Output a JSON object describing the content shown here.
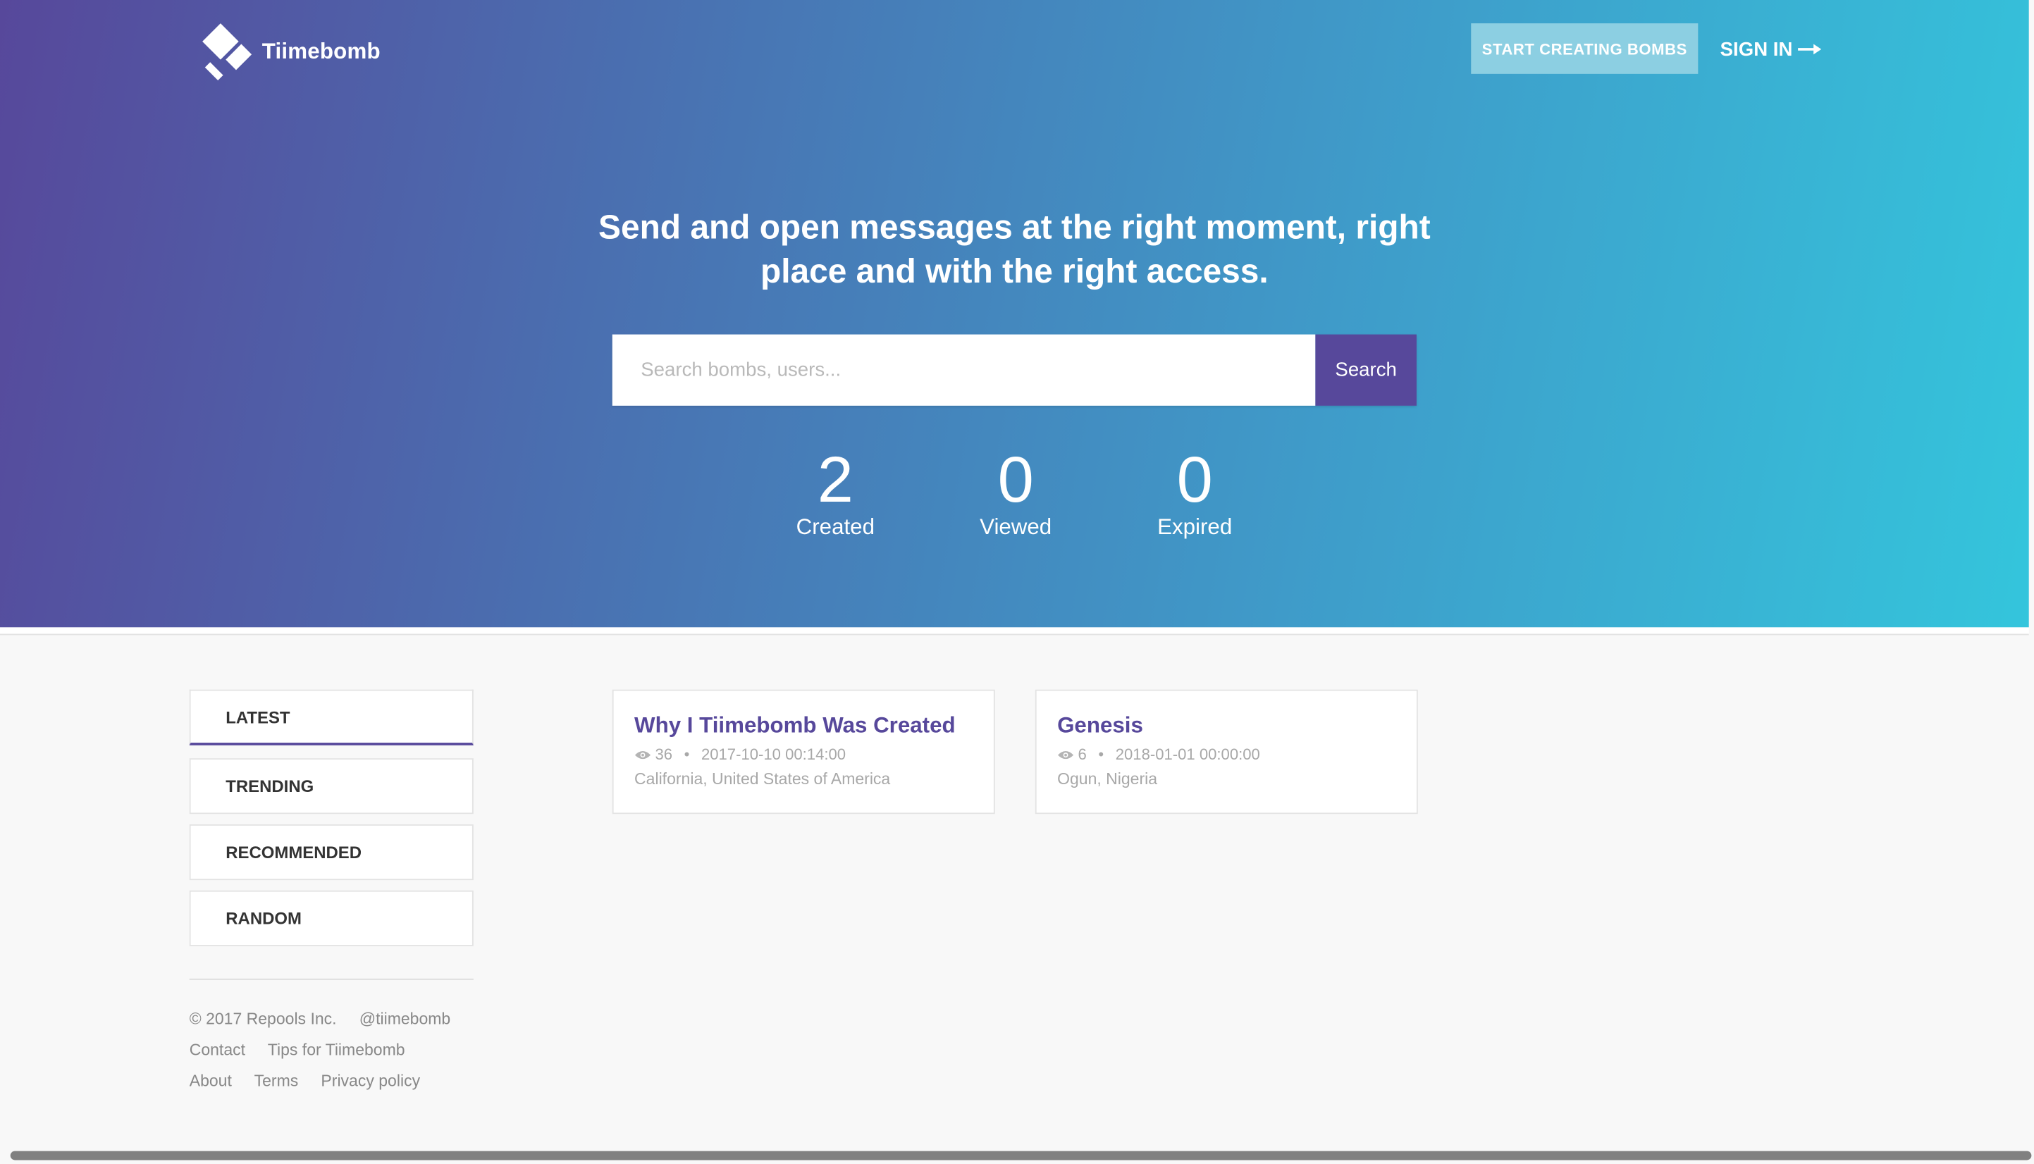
{
  "header": {
    "brand_name": "Tiimebomb",
    "logo_icon": "tiimebomb-diamond-logo",
    "start_button_label": "START CREATING BOMBS",
    "signin_label": "SIGN IN",
    "signin_icon": "arrow-right-icon"
  },
  "hero": {
    "tagline_line1": "Send and open messages at the right moment, right",
    "tagline_line2": "place and with the right access.",
    "search": {
      "placeholder": "Search bombs, users...",
      "value": "",
      "button_label": "Search"
    },
    "stats": [
      {
        "value": "2",
        "label": "Created"
      },
      {
        "value": "0",
        "label": "Viewed"
      },
      {
        "value": "0",
        "label": "Expired"
      }
    ]
  },
  "sidebar": {
    "tabs": [
      {
        "label": "LATEST",
        "active": true
      },
      {
        "label": "TRENDING",
        "active": false
      },
      {
        "label": "RECOMMENDED",
        "active": false
      },
      {
        "label": "RANDOM",
        "active": false
      }
    ]
  },
  "footer": {
    "copyright": "© 2017 Repools Inc.",
    "handle": "@tiimebomb",
    "contact": "Contact",
    "tips": "Tips for Tiimebomb",
    "about": "About",
    "terms": "Terms",
    "privacy": "Privacy policy"
  },
  "posts": [
    {
      "title": "Why I Tiimebomb Was Created",
      "views": "36",
      "date": "2017-10-10 00:14:00",
      "location": "California, United States of America"
    },
    {
      "title": "Genesis",
      "views": "6",
      "date": "2018-01-01 00:00:00",
      "location": "Ogun, Nigeria"
    }
  ],
  "colors": {
    "brand_purple": "#57489b",
    "gradient_start": "#57489b",
    "gradient_end": "#34c5dc",
    "start_button": "#8ccfe2"
  }
}
